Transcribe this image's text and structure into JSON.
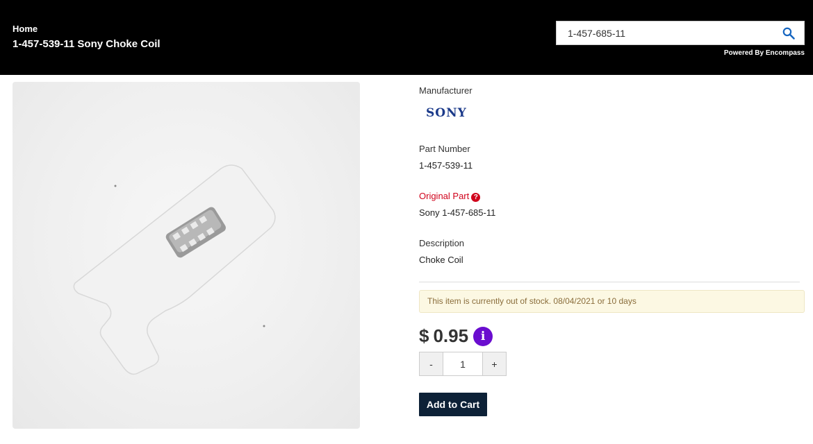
{
  "header": {
    "breadcrumb_home": "Home",
    "page_title": "1-457-539-11 Sony Choke Coil",
    "search_value": "1-457-685-11",
    "powered_by": "Powered By Encompass"
  },
  "product": {
    "manufacturer_label": "Manufacturer",
    "manufacturer_logo_text": "SONY",
    "part_number_label": "Part Number",
    "part_number": "1-457-539-11",
    "original_part_label": "Original Part",
    "original_part": "Sony 1-457-685-11",
    "description_label": "Description",
    "description": "Choke Coil",
    "stock_message": "This item is currently out of stock. 08/04/2021 or 10 days",
    "price_currency": "$",
    "price_value": "0.95",
    "quantity": "1",
    "qty_minus": "-",
    "qty_plus": "+",
    "add_to_cart": "Add to Cart"
  },
  "icons": {
    "search": "search-icon",
    "help": "question-circle-icon",
    "info": "info-circle-icon"
  },
  "colors": {
    "header_bg": "#000000",
    "original_part_label": "#d0021b",
    "info_icon": "#6a0dcf",
    "add_to_cart_bg": "#0d2137",
    "stock_alert_bg": "#fcf8e3",
    "sony_logo": "#1b3a8a"
  }
}
